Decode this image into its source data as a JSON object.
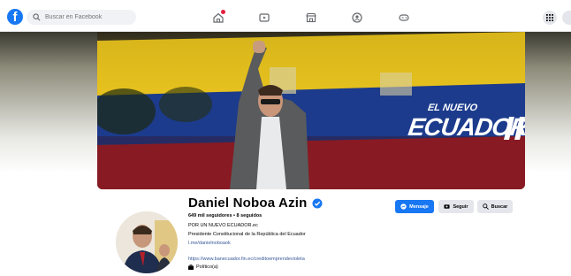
{
  "header": {
    "search_placeholder": "Buscar en Facebook",
    "nav_icons": [
      "home-icon",
      "video-icon",
      "marketplace-icon",
      "groups-icon",
      "gaming-icon"
    ],
    "menu_icon": "grid-menu-icon",
    "notification_dot_color": "#e41e3f"
  },
  "cover": {
    "subtitle": "EL NUEVO",
    "title": "ECUADOR",
    "flag_colors": [
      "#f5cc1a",
      "#1c3b8c",
      "#d4232a"
    ]
  },
  "profile": {
    "name": "Daniel Noboa Azin",
    "stats": "649 mil seguidores • 8 seguidos",
    "bio_line1": "POR UN NUEVO ECUADOR.ec",
    "bio_line2": "Presidente Constitucional de la República del Ecuador",
    "bio_link1": "l.me/danielnoboaok",
    "website": "https://www.banecuador.fin.ec/creditoemprendevioleta",
    "category": "Político(a)"
  },
  "actions": {
    "message_label": "Mensaje",
    "follow_label": "Seguir",
    "search_label": "Buscar"
  },
  "colors": {
    "brand": "#1877f2",
    "secondary_button": "#e4e6eb"
  }
}
